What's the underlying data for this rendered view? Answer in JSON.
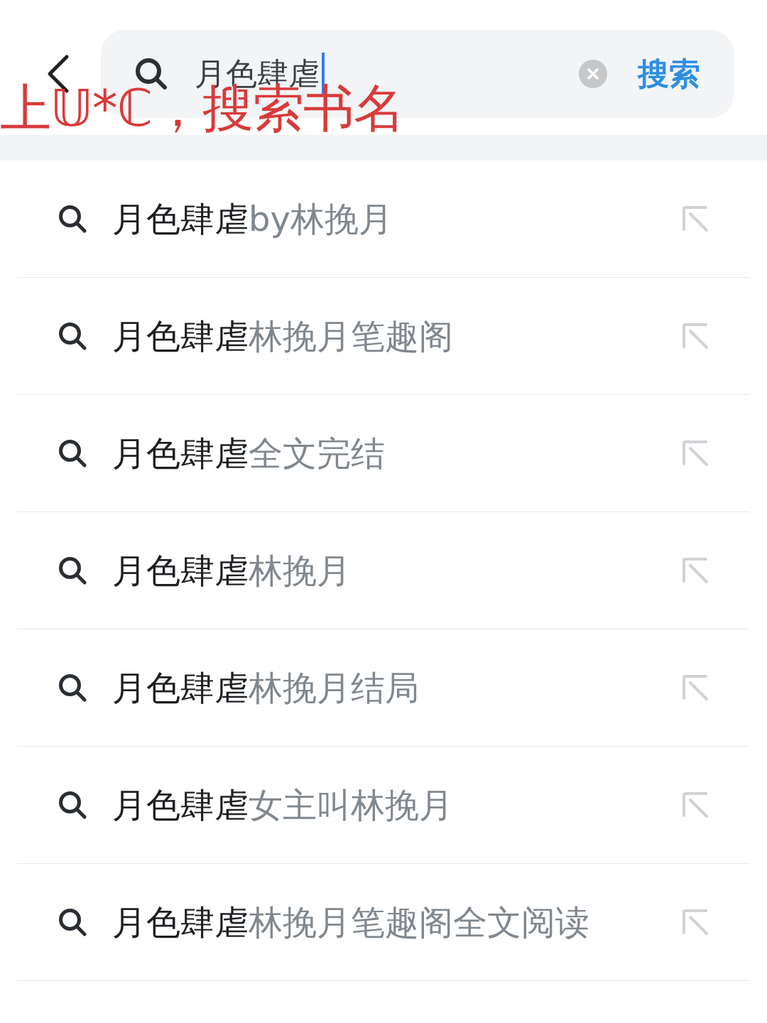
{
  "search_bar": {
    "query": "月色肆虐",
    "focused": true,
    "button": "搜索"
  },
  "suggestions": [
    {
      "match": "月色肆虐",
      "rest": "by林挽月"
    },
    {
      "match": "月色肆虐",
      "rest": "林挽月笔趣阁"
    },
    {
      "match": "月色肆虐",
      "rest": "全文完结"
    },
    {
      "match": "月色肆虐",
      "rest": "林挽月"
    },
    {
      "match": "月色肆虐",
      "rest": "林挽月结局"
    },
    {
      "match": "月色肆虐",
      "rest": "女主叫林挽月"
    },
    {
      "match": "月色肆虐",
      "rest": "林挽月笔趣阁全文阅读"
    }
  ],
  "annotation": "上𝕌*ℂ，搜索书名"
}
